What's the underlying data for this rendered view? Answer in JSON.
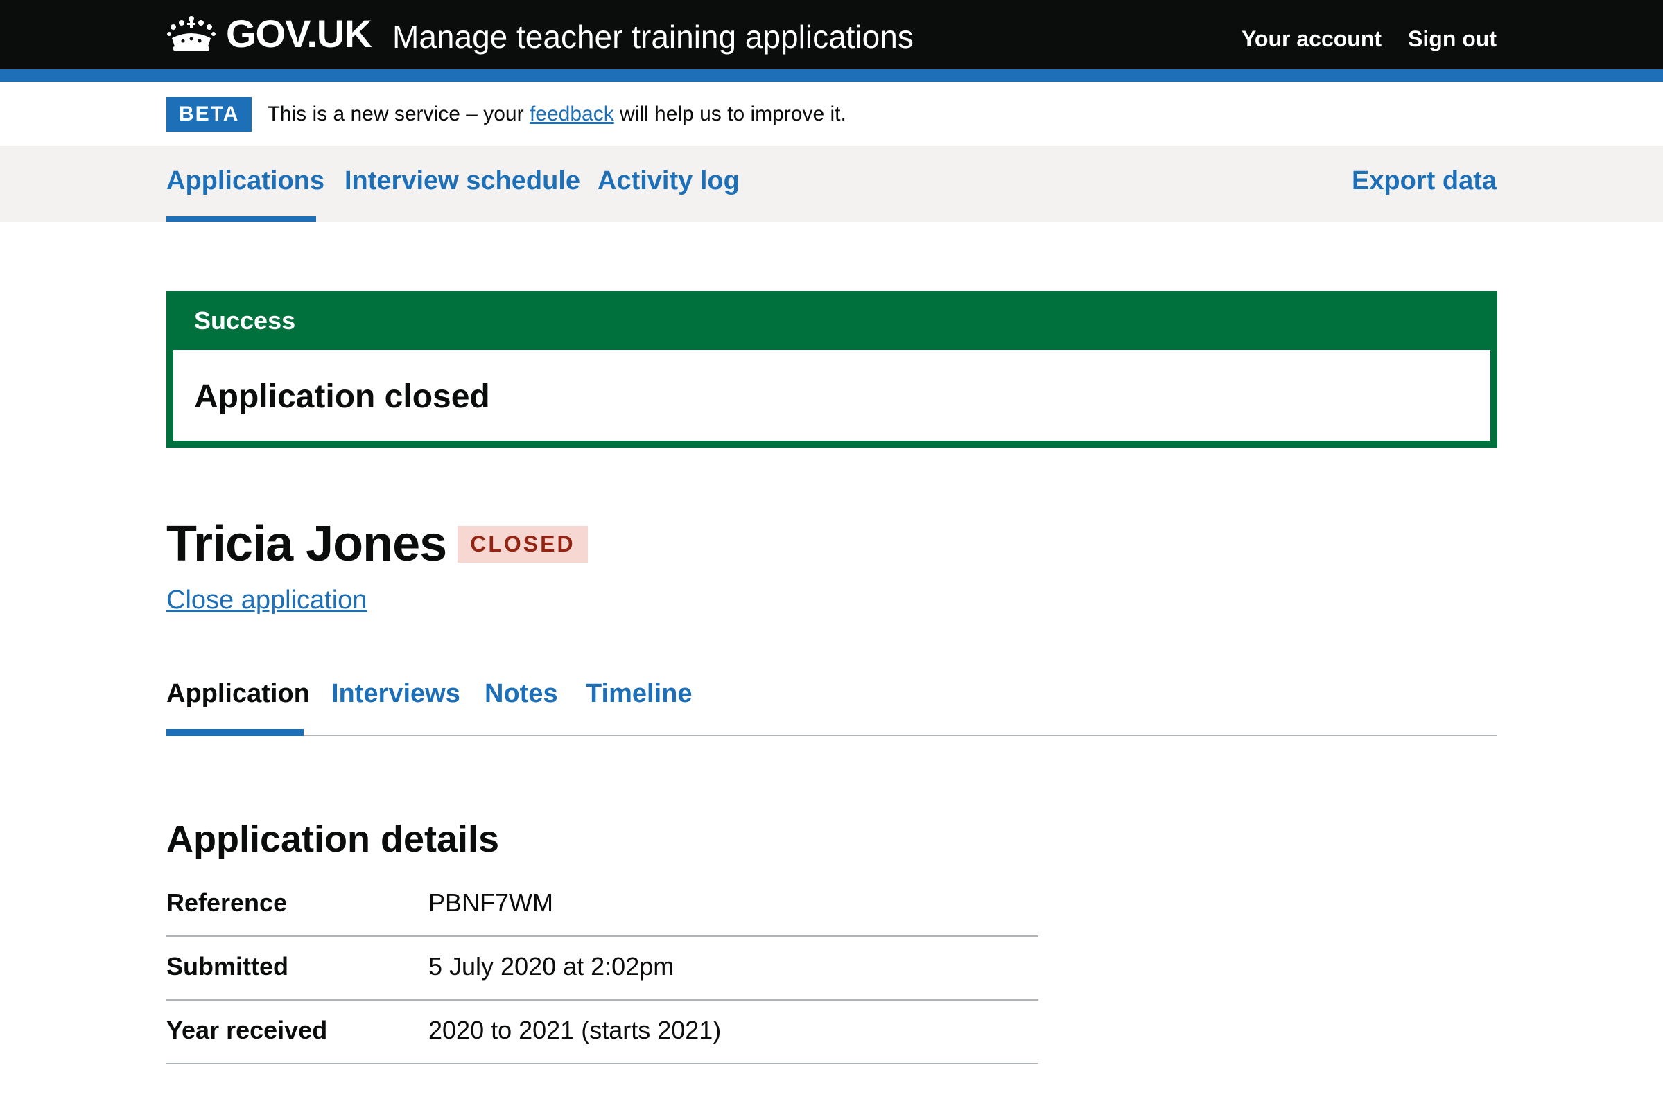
{
  "header": {
    "logo_text": "GOV.UK",
    "service_name": "Manage teacher training applications",
    "nav": [
      "Your account",
      "Sign out"
    ]
  },
  "phase_banner": {
    "tag": "BETA",
    "text_before": "This is a new service – your ",
    "link": "feedback",
    "text_after": " will help us to improve it."
  },
  "primary_nav": {
    "items": [
      "Applications",
      "Interview schedule",
      "Activity log"
    ],
    "right_item": "Export data",
    "active": "Applications"
  },
  "success_banner": {
    "title": "Success",
    "heading": "Application closed"
  },
  "candidate": {
    "name": "Tricia Jones",
    "status": "CLOSED",
    "action_link": "Close application"
  },
  "tabs": {
    "items": [
      "Application",
      "Interviews",
      "Notes",
      "Timeline"
    ],
    "active": "Application"
  },
  "application_details": {
    "heading": "Application details",
    "rows": [
      {
        "key": "Reference",
        "value": "PBNF7WM"
      },
      {
        "key": "Submitted",
        "value": "5 July 2020 at 2:02pm"
      },
      {
        "key": "Year received",
        "value": "2020 to 2021 (starts 2021)"
      }
    ]
  },
  "colors": {
    "header_bg": "#0b0c0c",
    "brand_blue": "#1d70b8",
    "success_green": "#00703c",
    "closed_tag_bg": "#f6d7d2",
    "closed_tag_text": "#942514",
    "nav_bg": "#f3f2f1"
  }
}
